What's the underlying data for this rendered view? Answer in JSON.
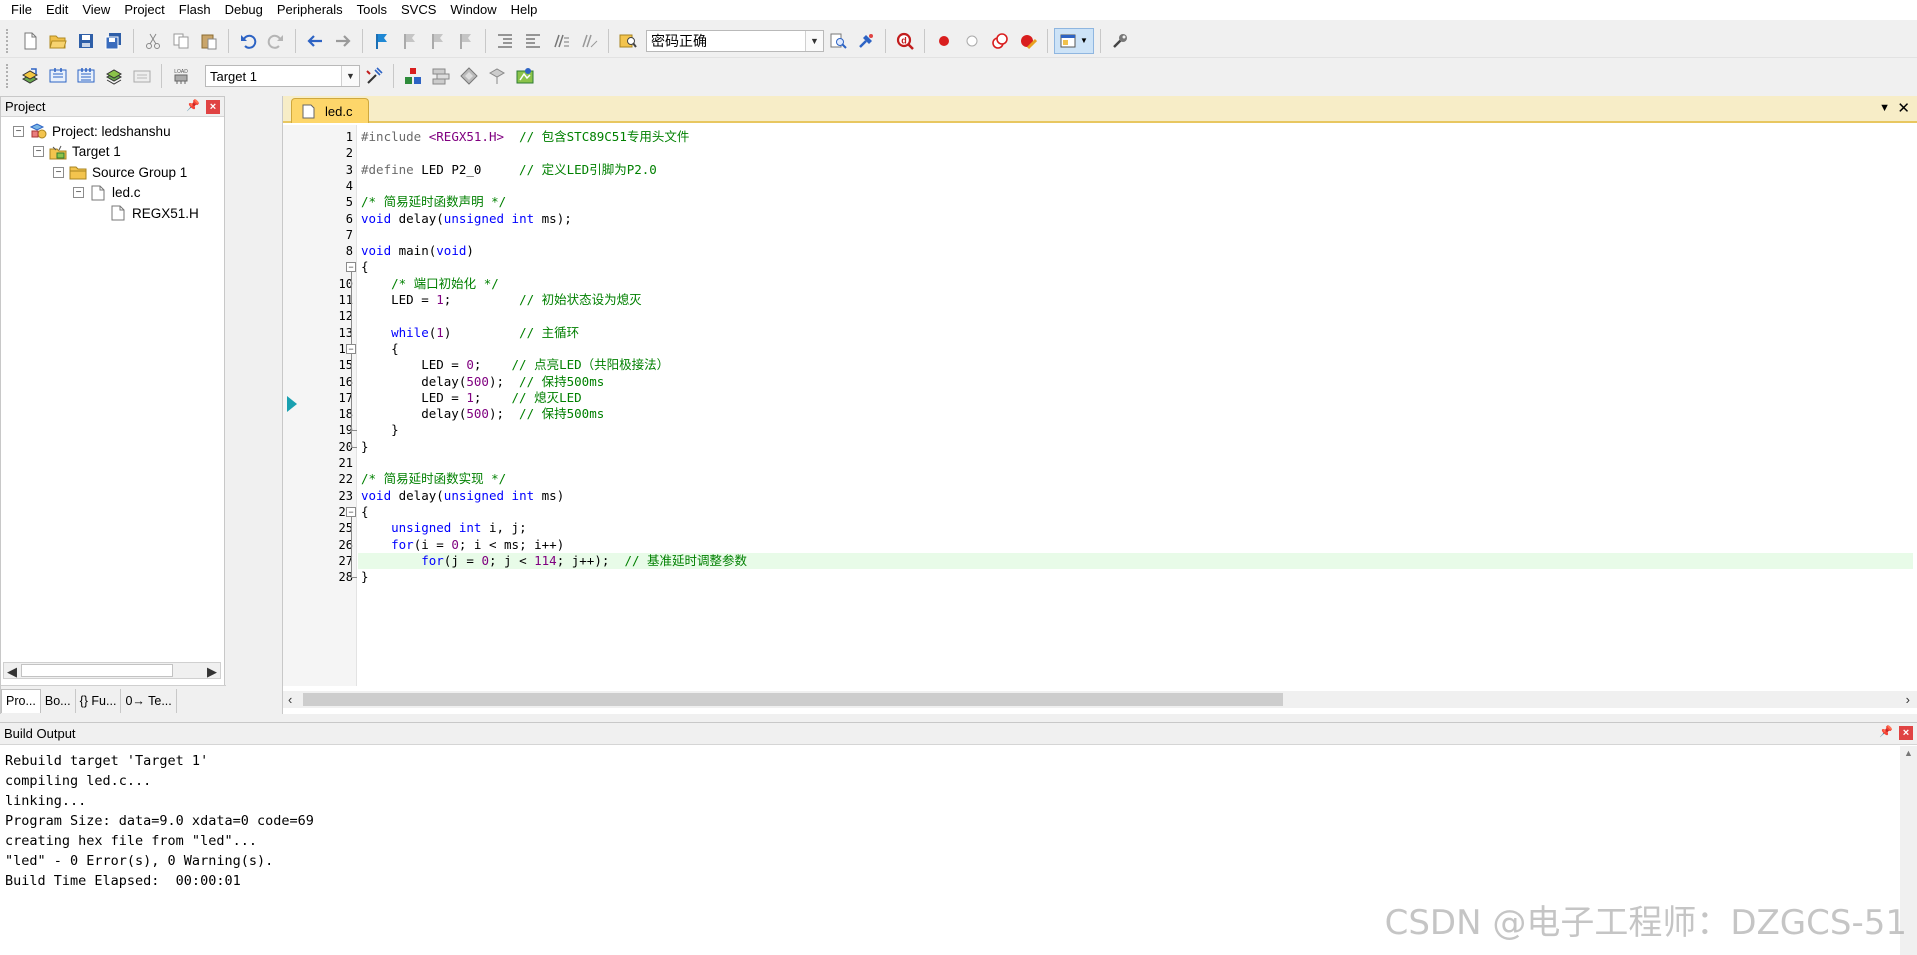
{
  "menu": [
    "File",
    "Edit",
    "View",
    "Project",
    "Flash",
    "Debug",
    "Peripherals",
    "Tools",
    "SVCS",
    "Window",
    "Help"
  ],
  "toolbar1": {
    "search_combo_value": "密码正确",
    "icons": [
      "new-file-icon",
      "open-icon",
      "save-icon",
      "save-all-icon",
      "cut-icon",
      "copy-icon",
      "paste-icon",
      "undo-icon",
      "redo-icon",
      "nav-back-icon",
      "nav-forward-icon",
      "bookmark-icon",
      "prev-bookmark-icon",
      "next-bookmark-icon",
      "clear-bookmarks-icon",
      "indent-icon",
      "unindent-icon",
      "comment-icon",
      "uncomment-icon",
      "find-in-files-icon",
      "find-icon",
      "debug-session-icon",
      "breakpoint-icon",
      "disable-breakpoint-icon",
      "kill-breakpoints-icon",
      "clear-breakpoints-icon",
      "window-layout-icon",
      "configure-icon"
    ]
  },
  "toolbar2": {
    "target_combo_value": "Target 1",
    "icons": [
      "translate-icon",
      "build-icon",
      "rebuild-icon",
      "batch-build-icon",
      "stop-build-icon",
      "download-icon",
      "options-icon",
      "manage-components-icon",
      "select-pack-icon",
      "books-icon",
      "select-software-icon",
      "event-recorder-icon"
    ]
  },
  "project_panel": {
    "title": "Project",
    "tree": [
      {
        "label": "Project: ledshanshu",
        "level": 0,
        "icon": "project-icon",
        "expander": "−"
      },
      {
        "label": "Target 1",
        "level": 1,
        "icon": "target-icon",
        "expander": "−"
      },
      {
        "label": "Source Group 1",
        "level": 2,
        "icon": "folder-icon",
        "expander": "−"
      },
      {
        "label": "led.c",
        "level": 3,
        "icon": "c-file-icon",
        "expander": "−"
      },
      {
        "label": "REGX51.H",
        "level": 4,
        "icon": "header-file-icon",
        "expander": ""
      }
    ],
    "tabs": [
      "Pro...",
      "Bo...",
      "{} Fu...",
      "0→ Te..."
    ]
  },
  "editor": {
    "tab_label": "led.c",
    "current_line": 10,
    "highlight_line": 27
  },
  "code_lines": [
    "#include <REGX51.H>  // 包含STC89C51专用头文件",
    "",
    "#define LED P2_0     // 定义LED引脚为P2.0",
    "",
    "/* 简易延时函数声明 */",
    "void delay(unsigned int ms);",
    "",
    "void main(void)",
    "{",
    "    /* 端口初始化 */",
    "    LED = 1;         // 初始状态设为熄灭",
    "",
    "    while(1)         // 主循环",
    "    {",
    "        LED = 0;    // 点亮LED（共阳极接法）",
    "        delay(500);  // 保持500ms",
    "        LED = 1;    // 熄灭LED",
    "        delay(500);  // 保持500ms",
    "    }",
    "}",
    "",
    "/* 简易延时函数实现 */",
    "void delay(unsigned int ms)",
    "{",
    "    unsigned int i, j;",
    "    for(i = 0; i < ms; i++)",
    "        for(j = 0; j < 114; j++);  // 基准延时调整参数",
    "}"
  ],
  "build_output": {
    "title": "Build Output",
    "lines": [
      "Rebuild target 'Target 1'",
      "compiling led.c...",
      "linking...",
      "Program Size: data=9.0 xdata=0 code=69",
      "creating hex file from \"led\"...",
      "\"led\" - 0 Error(s), 0 Warning(s).",
      "Build Time Elapsed:  00:00:01"
    ]
  },
  "watermark": "CSDN @电子工程师：DZGCS-51",
  "colors": {
    "keyword": "#0000ff",
    "comment": "#008000",
    "number": "#800080",
    "tab_active": "#fdd66a",
    "current_line_bg": "#e8fbe8"
  }
}
